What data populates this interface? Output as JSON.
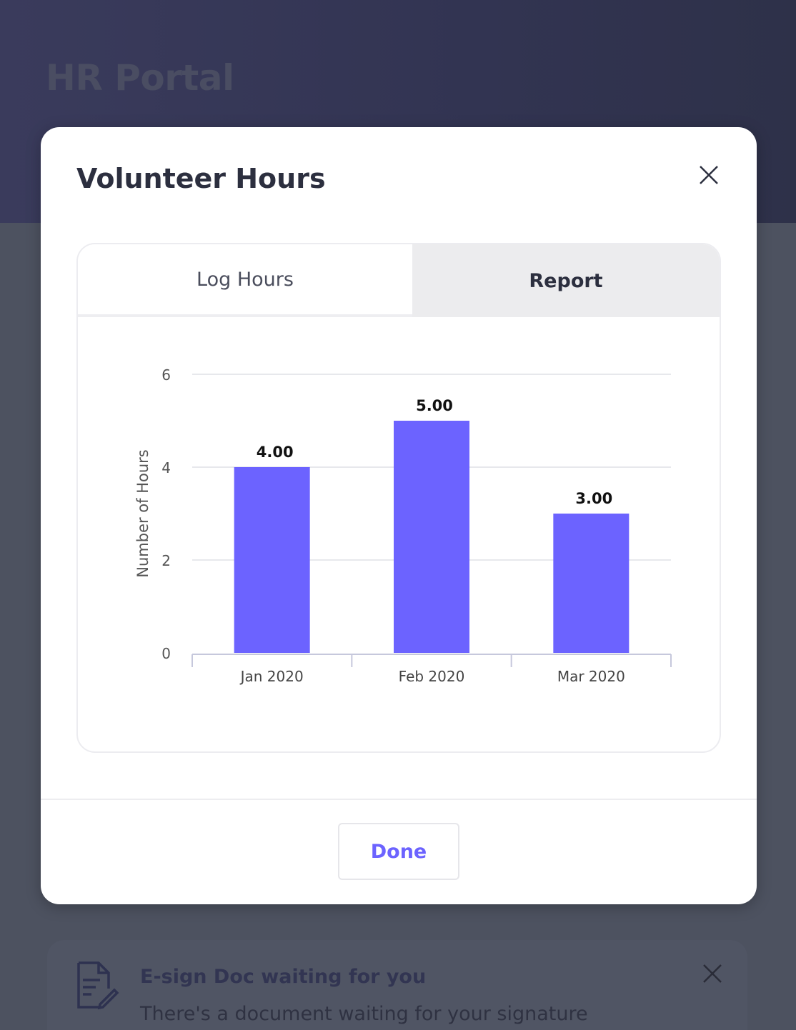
{
  "background": {
    "app_title": "HR Portal",
    "notice": {
      "title": "E-sign Doc waiting for you",
      "text": "There's a document waiting for your signature",
      "icon": "document-sign-icon"
    }
  },
  "modal": {
    "title": "Volunteer Hours",
    "close_icon": "close-icon",
    "tabs": [
      {
        "label": "Log Hours",
        "active": false
      },
      {
        "label": "Report",
        "active": true
      }
    ],
    "done_label": "Done"
  },
  "colors": {
    "accent": "#6c63ff",
    "bar": "#6c63ff",
    "header_bg": "#34364f"
  },
  "chart_data": {
    "type": "bar",
    "categories": [
      "Jan 2020",
      "Feb 2020",
      "Mar 2020"
    ],
    "values": [
      4.0,
      5.0,
      3.0
    ],
    "value_labels": [
      "4.00",
      "5.00",
      "3.00"
    ],
    "ylabel": "Number of Hours",
    "yticks": [
      0,
      2,
      4,
      6
    ],
    "ylim": [
      0,
      6
    ],
    "grid": true
  }
}
